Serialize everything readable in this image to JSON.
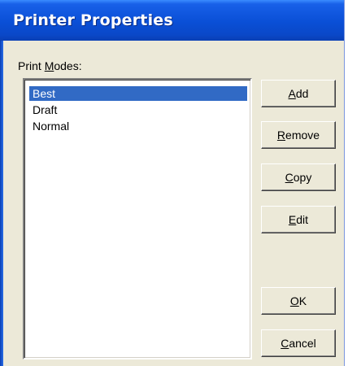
{
  "window": {
    "title": "Printer Properties"
  },
  "list": {
    "label_hotkey": "M",
    "label_prefix": "Print ",
    "label_suffix": "odes:",
    "items": [
      {
        "label": "Best",
        "selected": true
      },
      {
        "label": "Draft",
        "selected": false
      },
      {
        "label": "Normal",
        "selected": false
      }
    ]
  },
  "buttons": {
    "add": {
      "hotkey": "A",
      "rest": "dd"
    },
    "remove": {
      "hotkey": "R",
      "rest": "emove"
    },
    "copy": {
      "hotkey": "C",
      "rest": "opy"
    },
    "edit": {
      "hotkey": "E",
      "rest": "dit"
    },
    "ok": {
      "hotkey": "O",
      "rest": "K"
    },
    "cancel": {
      "hotkey": "C",
      "rest": "ancel"
    }
  },
  "colors": {
    "titlebar": "#0a4fd6",
    "selection": "#316ac5",
    "dialog_bg": "#ece9d8"
  }
}
